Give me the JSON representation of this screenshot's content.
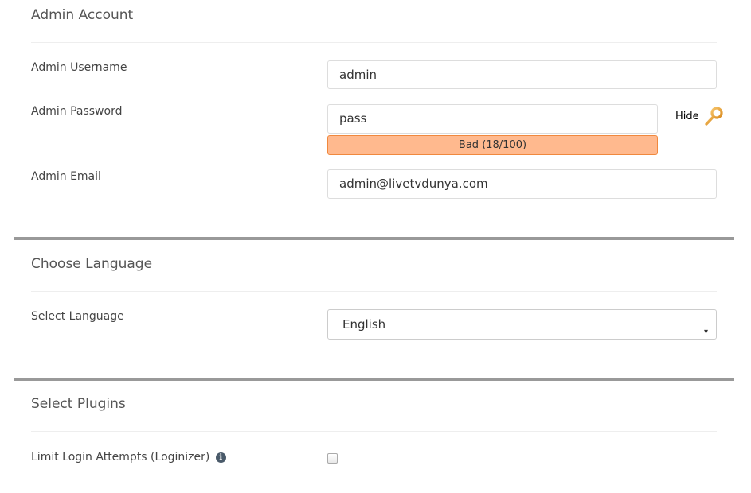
{
  "admin_account": {
    "heading": "Admin Account",
    "username": {
      "label": "Admin Username",
      "value": "admin"
    },
    "password": {
      "label": "Admin Password",
      "value": "pass",
      "strength_text": "Bad (18/100)",
      "strength_score": 18,
      "strength_color": "#ffb98e",
      "toggle_label": "Hide",
      "toggle_icon": "key-icon"
    },
    "email": {
      "label": "Admin Email",
      "value": "admin@livetvdunya.com"
    }
  },
  "choose_language": {
    "heading": "Choose Language",
    "select": {
      "label": "Select Language",
      "value": "English",
      "arrow": "▾"
    }
  },
  "select_plugins": {
    "heading": "Select Plugins",
    "plugins": [
      {
        "label": "Limit Login Attempts (Loginizer)",
        "checked": false,
        "info_icon": "i"
      }
    ]
  }
}
